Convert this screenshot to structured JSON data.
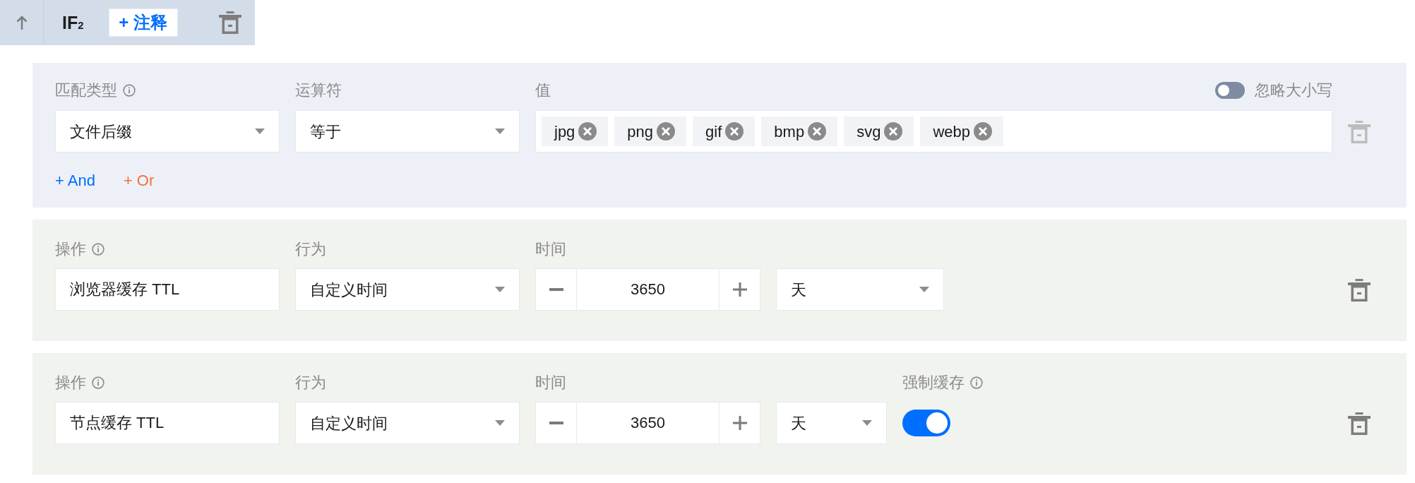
{
  "header": {
    "title": "IF$_{2}$",
    "annotate_button": "+ 注释"
  },
  "condition": {
    "delete_disabled": true,
    "fields": [
      {
        "kind": "select",
        "label": "匹配类型",
        "info": true,
        "value": "文件后缀"
      },
      {
        "kind": "select",
        "label": "运算符",
        "info": false,
        "value": "等于"
      },
      {
        "kind": "tags",
        "label": "值",
        "info": false,
        "tags": [
          "jpg",
          "png",
          "gif",
          "bmp",
          "svg",
          "webp"
        ]
      }
    ],
    "ignore_case": {
      "label": "忽略大小写",
      "on": false
    },
    "links": [
      {
        "text": "+ And",
        "color": "#006eff"
      },
      {
        "text": "+ Or",
        "color": "#f2703f"
      }
    ]
  },
  "actions": [
    {
      "delete_disabled": false,
      "fields": [
        {
          "kind": "input",
          "label": "操作",
          "info": true,
          "value": "浏览器缓存 TTL"
        },
        {
          "kind": "select",
          "label": "行为",
          "info": false,
          "value": "自定义时间"
        },
        {
          "kind": "duration",
          "label": "时间",
          "info": false,
          "value": "3650",
          "unit": "天"
        }
      ]
    },
    {
      "delete_disabled": false,
      "fields": [
        {
          "kind": "input",
          "label": "操作",
          "info": true,
          "value": "节点缓存 TTL"
        },
        {
          "kind": "select",
          "label": "行为",
          "info": false,
          "value": "自定义时间"
        },
        {
          "kind": "duration",
          "label": "时间",
          "info": false,
          "value": "3650",
          "unit": "天"
        },
        {
          "kind": "switch",
          "label": "强制缓存",
          "info": true,
          "on": true
        }
      ]
    }
  ]
}
